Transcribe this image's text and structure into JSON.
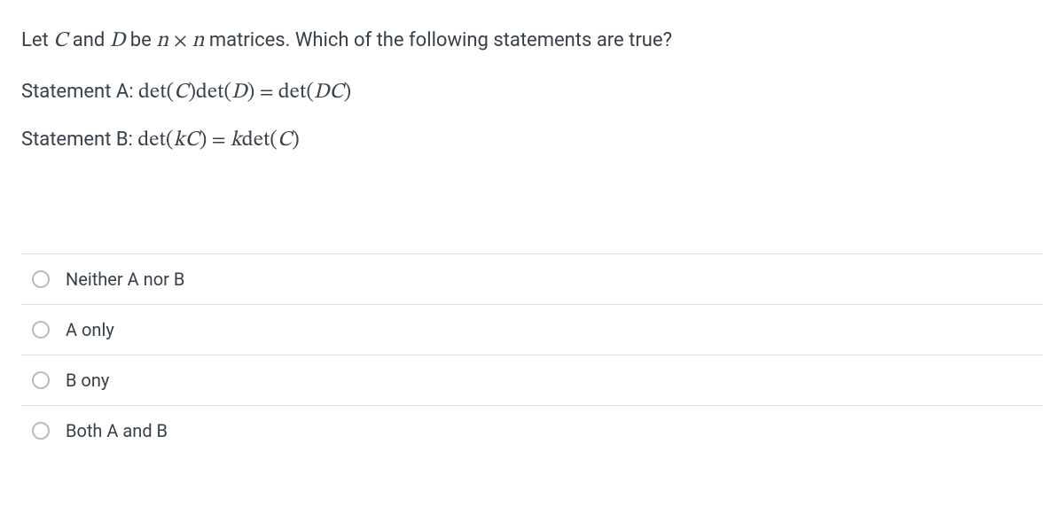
{
  "question": {
    "intro_pre": "Let ",
    "var_C": "C",
    "intro_and": " and ",
    "var_D": "D",
    "intro_be": " be ",
    "var_n1": "n",
    "times": " × ",
    "var_n2": "n",
    "intro_post": " matrices. Which of the following statements are true?"
  },
  "statement_a": {
    "label": "Statement A: ",
    "lhs_det1": "det",
    "lhs_p1o": "(",
    "lhs_C": "C",
    "lhs_p1c": ")",
    "lhs_det2": "det",
    "lhs_p2o": "(",
    "lhs_D": "D",
    "lhs_p2c": ")",
    "eq": " = ",
    "rhs_det": "det",
    "rhs_po": "(",
    "rhs_D": "D",
    "rhs_C": "C",
    "rhs_pc": ")"
  },
  "statement_b": {
    "label": "Statement B: ",
    "lhs_det": "det",
    "lhs_po": "(",
    "lhs_k": "k",
    "lhs_C": "C",
    "lhs_pc": ")",
    "eq": " = ",
    "rhs_k": "k",
    "rhs_det": "det",
    "rhs_po": "(",
    "rhs_C": "C",
    "rhs_pc": ")"
  },
  "options": {
    "o1": "Neither A nor B",
    "o2": "A only",
    "o3": "B ony",
    "o4": "Both A and B"
  }
}
